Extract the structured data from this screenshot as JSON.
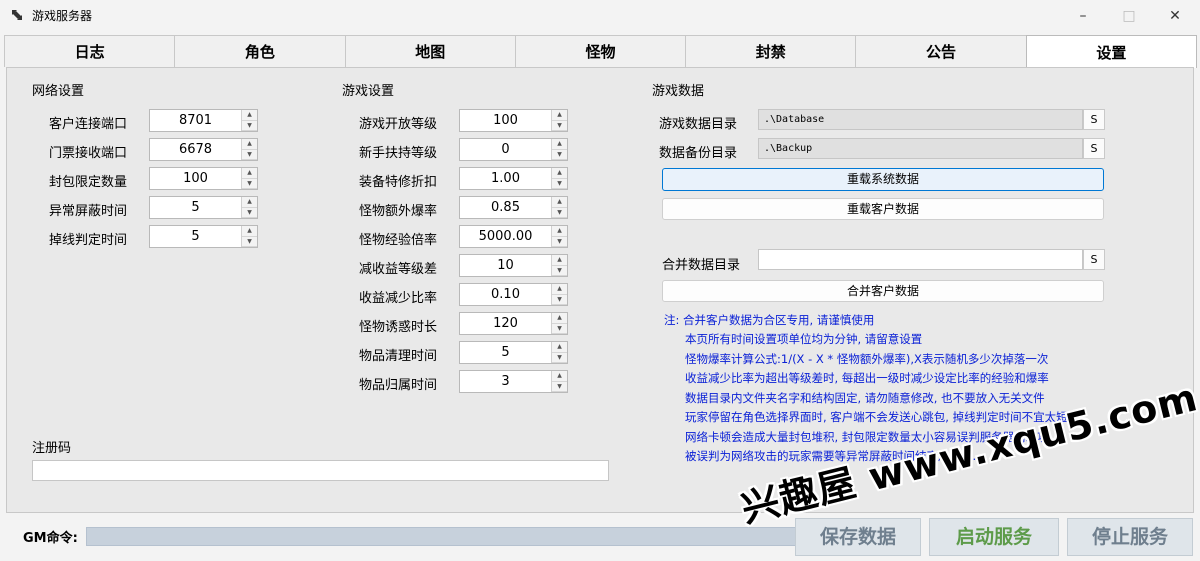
{
  "window": {
    "title": "游戏服务器",
    "minimize_icon": "minimize-icon",
    "maximize_icon": "maximize-icon",
    "close_icon": "close-icon"
  },
  "tabs": [
    {
      "label": "日志"
    },
    {
      "label": "角色"
    },
    {
      "label": "地图"
    },
    {
      "label": "怪物"
    },
    {
      "label": "封禁"
    },
    {
      "label": "公告"
    },
    {
      "label": "设置",
      "active": true
    }
  ],
  "network": {
    "title": "网络设置",
    "rows": [
      {
        "label": "客户连接端口",
        "value": "8701"
      },
      {
        "label": "门票接收端口",
        "value": "6678"
      },
      {
        "label": "封包限定数量",
        "value": "100"
      },
      {
        "label": "异常屏蔽时间",
        "value": "5"
      },
      {
        "label": "掉线判定时间",
        "value": "5"
      }
    ]
  },
  "game": {
    "title": "游戏设置",
    "rows": [
      {
        "label": "游戏开放等级",
        "value": "100"
      },
      {
        "label": "新手扶持等级",
        "value": "0"
      },
      {
        "label": "装备特修折扣",
        "value": "1.00"
      },
      {
        "label": "怪物额外爆率",
        "value": "0.85"
      },
      {
        "label": "怪物经验倍率",
        "value": "5000.00"
      },
      {
        "label": "减收益等级差",
        "value": "10"
      },
      {
        "label": "收益减少比率",
        "value": "0.10"
      },
      {
        "label": "怪物诱惑时长",
        "value": "120"
      },
      {
        "label": "物品清理时间",
        "value": "5"
      },
      {
        "label": "物品归属时间",
        "value": "3"
      }
    ]
  },
  "gamedata": {
    "title": "游戏数据",
    "data_dir_label": "游戏数据目录",
    "data_dir_value": ".\\Database",
    "backup_dir_label": "数据备份目录",
    "backup_dir_value": ".\\Backup",
    "s_label": "S",
    "reload_system": "重载系统数据",
    "reload_client": "重载客户数据",
    "merge_dir_label": "合并数据目录",
    "merge_dir_value": "",
    "merge_client": "合并客户数据"
  },
  "notes": [
    "注:  合并客户数据为合区专用, 请谨慎使用",
    "本页所有时间设置项单位均为分钟, 请留意设置",
    "怪物爆率计算公式:1/(X - X * 怪物额外爆率),X表示随机多少次掉落一次",
    "收益减少比率为超出等级差时, 每超出一级时减少设定比率的经验和爆率",
    "数据目录内文件夹名字和结构固定, 请勿随意修改, 也不要放入无关文件",
    "玩家停留在角色选择界面时, 客户端不会发送心跳包, 掉线判定时间不宜太短",
    "网络卡顿会造成大量封包堆积, 封包限定数量太小容易误判服务器请求攻",
    "被误判为网络攻击的玩家需要等异常屏蔽时间结束后才能..."
  ],
  "register": {
    "label": "注册码",
    "value": ""
  },
  "bottom": {
    "gm_label": "GM命令:",
    "gm_value": "",
    "save": "保存数据",
    "start": "启动服务",
    "stop": "停止服务"
  },
  "watermark": "兴趣屋 www.xqu5.com",
  "colors": {
    "note_text": "#0b21d6",
    "start_button_text": "#5d9b4a",
    "focus_border": "#0078d4"
  }
}
